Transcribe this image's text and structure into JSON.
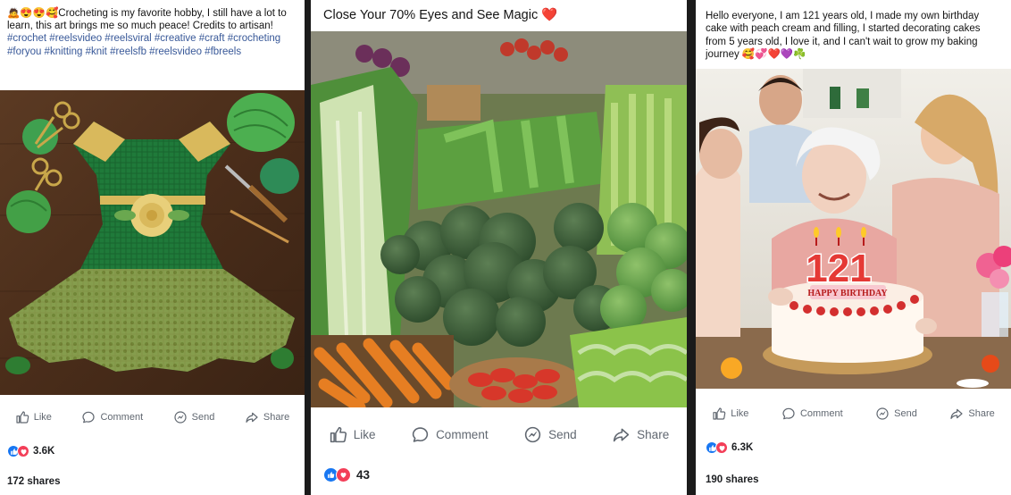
{
  "posts": [
    {
      "caption_text": "🙇😍😍🥰Crocheting is my favorite hobby, I still have a lot to learn, this art brings me so much peace! Credits to artisan!",
      "caption_tags": "#crochet #reelsvideo #reelsviral #creative #craft #crocheting #foryou #knitting #knit #reelsfb #reelsvideo #fbreels",
      "actions": {
        "like": "Like",
        "comment": "Comment",
        "send": "Send",
        "share": "Share"
      },
      "reaction_count": "3.6K",
      "shares": "172 shares"
    },
    {
      "caption_text": "Close Your 70% Eyes and See Magic ❤️",
      "actions": {
        "like": "Like",
        "comment": "Comment",
        "send": "Send",
        "share": "Share"
      },
      "reaction_count": "43"
    },
    {
      "caption_text": "Hello everyone, I am 121 years old, I made my own birthday cake with peach cream and filling, I started decorating cakes from 5 years old, I love it, and I can't wait to grow my baking journey 🥰💞❤️💜☘️",
      "cake_number": "121",
      "cake_banner": "HAPPY BIRTHDAY",
      "actions": {
        "like": "Like",
        "comment": "Comment",
        "send": "Send",
        "share": "Share"
      },
      "reaction_count": "6.3K",
      "shares": "190 shares"
    }
  ],
  "colors": {
    "like": "#1877f2",
    "love": "#f33e58",
    "hashtag": "#385898",
    "action_text": "#606770"
  },
  "icons": [
    "like-icon",
    "comment-icon",
    "send-icon",
    "share-icon",
    "like-reaction-icon",
    "love-reaction-icon"
  ]
}
